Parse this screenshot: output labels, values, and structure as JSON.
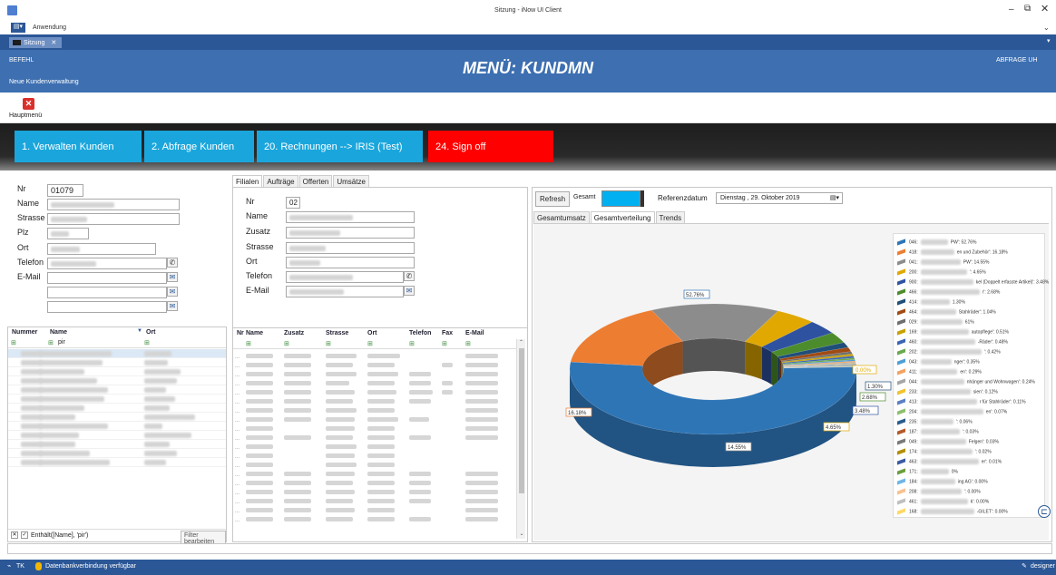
{
  "window": {
    "title": "Sitzung - iNow UI Client",
    "menu_label": "Anwendung",
    "tab_label": "Sitzung"
  },
  "header": {
    "left_label": "BEFEHL",
    "subtitle": "Neue Kundenverwaltung",
    "title": "MENÜ: KUNDMN",
    "right_label": "ABFRAGE UH"
  },
  "toolbar": {
    "close_label": "Hauptmenü"
  },
  "menu_tiles": [
    {
      "label": "1. Verwalten Kunden",
      "color": "#1aa6dc"
    },
    {
      "label": "2. Abfrage Kunden",
      "color": "#1aa6dc"
    },
    {
      "label": "20. Rechnungen --> IRIS (Test)",
      "color": "#1aa6dc"
    },
    {
      "label": "24. Sign off",
      "color": "#ff0000"
    }
  ],
  "customer_form": {
    "nr_label": "Nr",
    "nr_value": "01079",
    "name_label": "Name",
    "strasse_label": "Strasse",
    "plz_label": "Plz",
    "ort_label": "Ort",
    "telefon_label": "Telefon",
    "email_label": "E-Mail"
  },
  "customer_grid": {
    "columns": [
      "Nummer",
      "Name",
      "Ort"
    ],
    "filter_name_value": "pir",
    "filter_text": "Enthält([Name], 'pir')",
    "filter_button": "Filter bearbeiten"
  },
  "detail_tabs": [
    "Filialen",
    "Aufträge",
    "Offerten",
    "Umsätze"
  ],
  "branch_form": {
    "nr_label": "Nr",
    "nr_value": "02",
    "name_label": "Name",
    "zusatz_label": "Zusatz",
    "strasse_label": "Strasse",
    "ort_label": "Ort",
    "telefon_label": "Telefon",
    "email_label": "E-Mail"
  },
  "branch_grid": {
    "columns": [
      "Nr",
      "Name",
      "Zusatz",
      "Strasse",
      "Ort",
      "Telefon",
      "Fax",
      "E-Mail"
    ]
  },
  "chart_panel": {
    "refresh_label": "Refresh",
    "gesamt_label": "Gesamt",
    "ref_label": "Referenzdatum",
    "date_value": "Dienstag , 29. Oktober 2019",
    "tabs": [
      "Gesamtumsatz",
      "Gesamtverteilung",
      "Trends"
    ],
    "active_tab": "Gesamtverteilung"
  },
  "chart_data": {
    "type": "pie",
    "style": "3d-donut",
    "slices": [
      {
        "code": "046",
        "suffix": "PW': 52.76%",
        "value": 52.76,
        "color": "#2e75b6",
        "label": "52.76%"
      },
      {
        "code": "418",
        "suffix": "en und Zubehör': 16.18%",
        "value": 16.18,
        "color": "#ed7d31",
        "label": "16.18%"
      },
      {
        "code": "041",
        "suffix": "PW': 14.55%",
        "value": 14.55,
        "color": "#8c8c8c",
        "label": "14.55%"
      },
      {
        "code": "200",
        "suffix": "': 4.65%",
        "value": 4.65,
        "color": "#e0a800",
        "label": "4.65%"
      },
      {
        "code": "900",
        "suffix": "kel (Doppelt erfasste Artikel)': 3.48%",
        "value": 3.48,
        "color": "#2f52a0",
        "label": "3.48%"
      },
      {
        "code": "466",
        "suffix": "r': 2.68%",
        "value": 2.68,
        "color": "#4c8c2c",
        "label": "2.68%"
      },
      {
        "code": "414",
        "suffix": "1.30%",
        "value": 1.3,
        "color": "#1f4e79",
        "label": "1.30%"
      },
      {
        "code": "464",
        "suffix": "Stahlräder': 1.04%",
        "value": 1.04,
        "color": "#a04b14",
        "label": ""
      },
      {
        "code": "029",
        "suffix": "61%",
        "value": 0.61,
        "color": "#6e6e6e",
        "label": ""
      },
      {
        "code": "169",
        "suffix": "autopflege': 0.51%",
        "value": 0.51,
        "color": "#c8a000",
        "label": ""
      },
      {
        "code": "460",
        "suffix": "-Räder': 0.48%",
        "value": 0.48,
        "color": "#3a64b4",
        "label": ""
      },
      {
        "code": "202",
        "suffix": "': 0.42%",
        "value": 0.42,
        "color": "#6aa84f",
        "label": ""
      },
      {
        "code": "043",
        "suffix": "nger': 0.35%",
        "value": 0.35,
        "color": "#4f9fd6",
        "label": ""
      },
      {
        "code": "411",
        "suffix": "en': 0.29%",
        "value": 0.29,
        "color": "#f4a261",
        "label": ""
      },
      {
        "code": "044",
        "suffix": "nhänger und Wohnwagen': 0.24%",
        "value": 0.24,
        "color": "#a6a6a6",
        "label": ""
      },
      {
        "code": "233",
        "suffix": "sien': 0.12%",
        "value": 0.12,
        "color": "#f1c232",
        "label": ""
      },
      {
        "code": "413",
        "suffix": "r für Stahlräder': 0.11%",
        "value": 0.11,
        "color": "#5b7fc4",
        "label": ""
      },
      {
        "code": "204",
        "suffix": "en': 0.07%",
        "value": 0.07,
        "color": "#8fbf6e",
        "label": ""
      },
      {
        "code": "235",
        "suffix": "': 0.06%",
        "value": 0.06,
        "color": "#2a5d8c",
        "label": ""
      },
      {
        "code": "187",
        "suffix": "': 0.03%",
        "value": 0.03,
        "color": "#b45a2a",
        "label": ""
      },
      {
        "code": "049",
        "suffix": "Felgen': 0.03%",
        "value": 0.03,
        "color": "#7a7a7a",
        "label": ""
      },
      {
        "code": "174",
        "suffix": "': 0.02%",
        "value": 0.02,
        "color": "#b38f00",
        "label": ""
      },
      {
        "code": "463",
        "suffix": "er': 0.01%",
        "value": 0.01,
        "color": "#3c5aa0",
        "label": ""
      },
      {
        "code": "171",
        "suffix": "0%",
        "value": 0.0,
        "color": "#6b9e3f",
        "label": ""
      },
      {
        "code": "184",
        "suffix": "ing AG': 0.00%",
        "value": 0.0,
        "color": "#6fb6e8",
        "label": ""
      },
      {
        "code": "208",
        "suffix": "': 0.00%",
        "value": 0.0,
        "color": "#f8c291",
        "label": ""
      },
      {
        "code": "461",
        "suffix": "k': 0.00%",
        "value": 0.0,
        "color": "#bfbfbf",
        "label": ""
      },
      {
        "code": "168",
        "suffix": "-GILET': 0.00%",
        "value": 0.0,
        "color": "#ffd966",
        "label": ""
      }
    ],
    "extra_labels": [
      "0.00%"
    ]
  },
  "status": {
    "tk_label": "TK",
    "db_text": "Datenbankverbindung verfügbar",
    "designer_label": "designer"
  }
}
